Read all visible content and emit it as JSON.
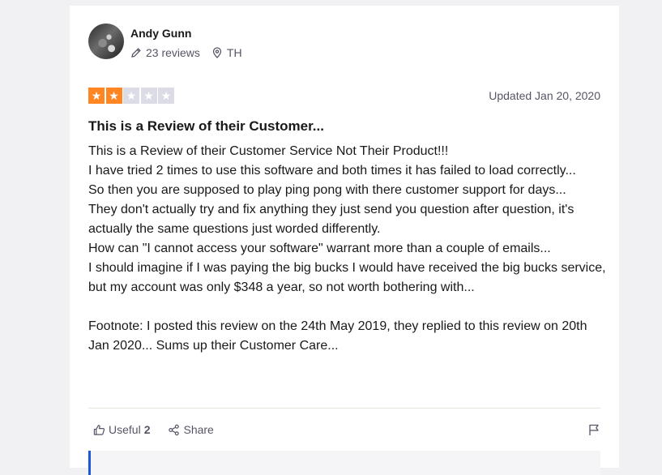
{
  "reviewer": {
    "name": "Andy Gunn",
    "reviews": "23 reviews",
    "location": "TH"
  },
  "rating": {
    "stars": 2,
    "max": 5
  },
  "date": "Updated Jan 20, 2020",
  "review": {
    "title": "This is a Review of their Customer...",
    "lines": [
      "This is a Review of their Customer Service Not Their Product!!!",
      "I have tried 2 times to use this software and both times it has failed to load correctly...",
      "So then you are supposed to play ping pong with there customer support for days...",
      "They don't actually try and fix anything they just send you question after question, it's actually the same questions just worded differently.",
      "How can \"I cannot access your software\" warrant more than a couple of emails...",
      "I should imagine if I was paying the big bucks I would have received the big bucks service, but my account was only $348 a year, so not worth bothering with...",
      "",
      "Footnote: I posted this review on the 24th May 2019, they replied to this review on 20th Jan 2020... Sums up their Customer Care..."
    ]
  },
  "actions": {
    "useful_label": "Useful",
    "useful_count": "2",
    "share_label": "Share"
  },
  "colors": {
    "star_on": "#ff8622",
    "star_off": "#dcdce6",
    "reply_accent": "#1c59d9"
  },
  "icons": {
    "reviews": "pencil-icon",
    "location": "location-pin-icon",
    "useful": "thumbs-up-icon",
    "share": "share-icon",
    "flag": "flag-icon",
    "star": "star-icon"
  }
}
